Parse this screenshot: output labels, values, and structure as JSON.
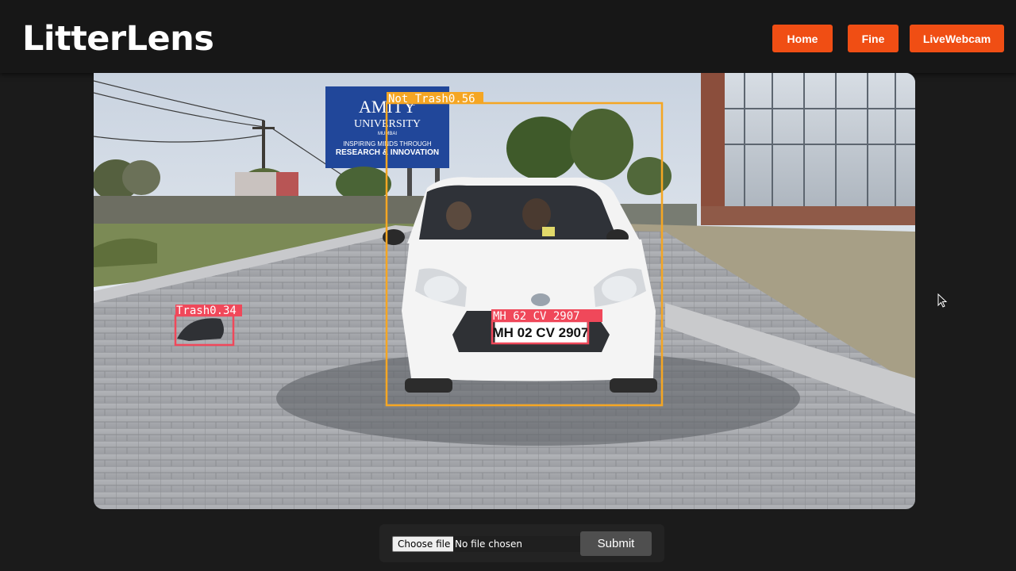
{
  "header": {
    "brand": "LitterLens",
    "nav": [
      {
        "label": "Home"
      },
      {
        "label": "Fine"
      },
      {
        "label": "LiveWebcam"
      }
    ]
  },
  "scene": {
    "billboard_logo": "AMITY",
    "billboard_sub": "UNIVERSITY",
    "billboard_city": "MUMBAI",
    "billboard_line1": "INSPIRING MINDS THROUGH",
    "billboard_line2": "RESEARCH & INNOVATION",
    "plate_text": "MH 02 CV 2907",
    "detections": [
      {
        "label": "Not_Trash0.56",
        "color": "#f5a623"
      },
      {
        "label": "Trash0.34",
        "color": "#f0485a"
      },
      {
        "label": "MH 62 CV 2907",
        "color": "#f0485a"
      }
    ]
  },
  "upload": {
    "choose_label": "Choose file",
    "status": "No file chosen",
    "submit_label": "Submit"
  },
  "colors": {
    "accent": "#f04e14",
    "background": "#1b1b1b"
  }
}
